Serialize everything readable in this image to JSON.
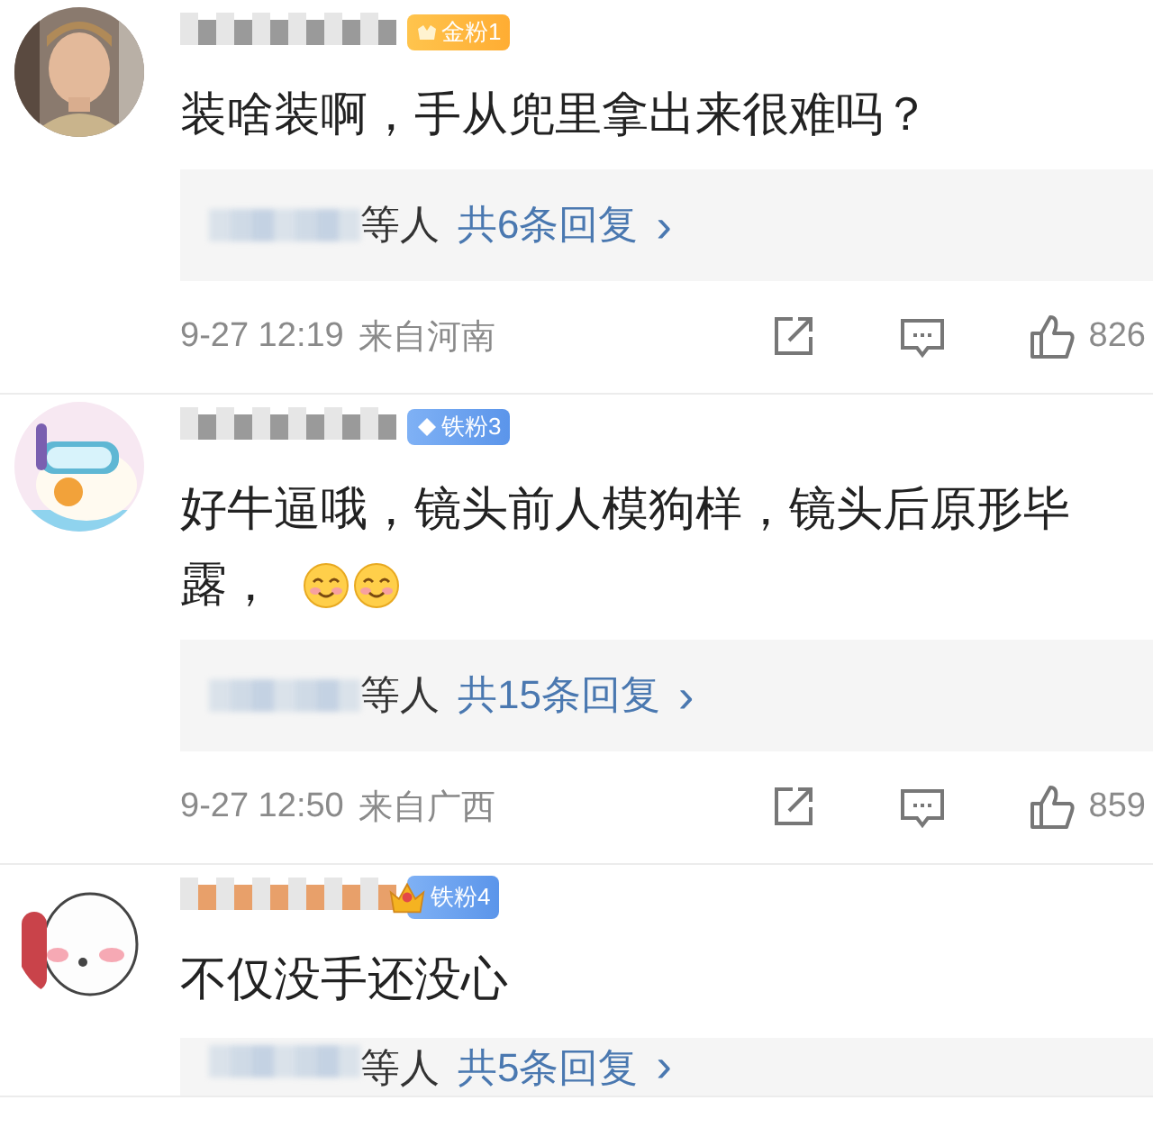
{
  "comments": [
    {
      "color": "#9a9a9a",
      "badge": {
        "kind": "gold",
        "label": "金粉1"
      },
      "text": "装啥装啊，手从兜里拿出来很难吗？",
      "replies": {
        "suffix": "等人",
        "count": "共6条回复",
        "arrow": "›"
      },
      "time": "9-27 12:19",
      "location": "来自河南",
      "likes": "826"
    },
    {
      "avatar": {
        "kind": "goggles"
      },
      "color": "#9a9a9a",
      "badge": {
        "kind": "iron",
        "label": "铁粉3"
      },
      "text": "好牛逼哦，镜头前人模狗样，镜头后原形毕露，",
      "emojis": [
        {
          "kind": "smile"
        },
        {
          "kind": "smile"
        }
      ],
      "replies": {
        "suffix": "等人",
        "count": "共15条回复",
        "arrow": "›"
      },
      "time": "9-27 12:50",
      "location": "来自广西",
      "likes": "859"
    },
    {
      "avatar": {
        "kind": "phone"
      },
      "color": "#e8a06a",
      "badge": {
        "kind": "crown",
        "label": "铁粉4"
      },
      "text": "不仅没手还没心",
      "replies": {
        "suffix": "等人",
        "count": "共5条回复",
        "arrow": "›"
      }
    }
  ]
}
